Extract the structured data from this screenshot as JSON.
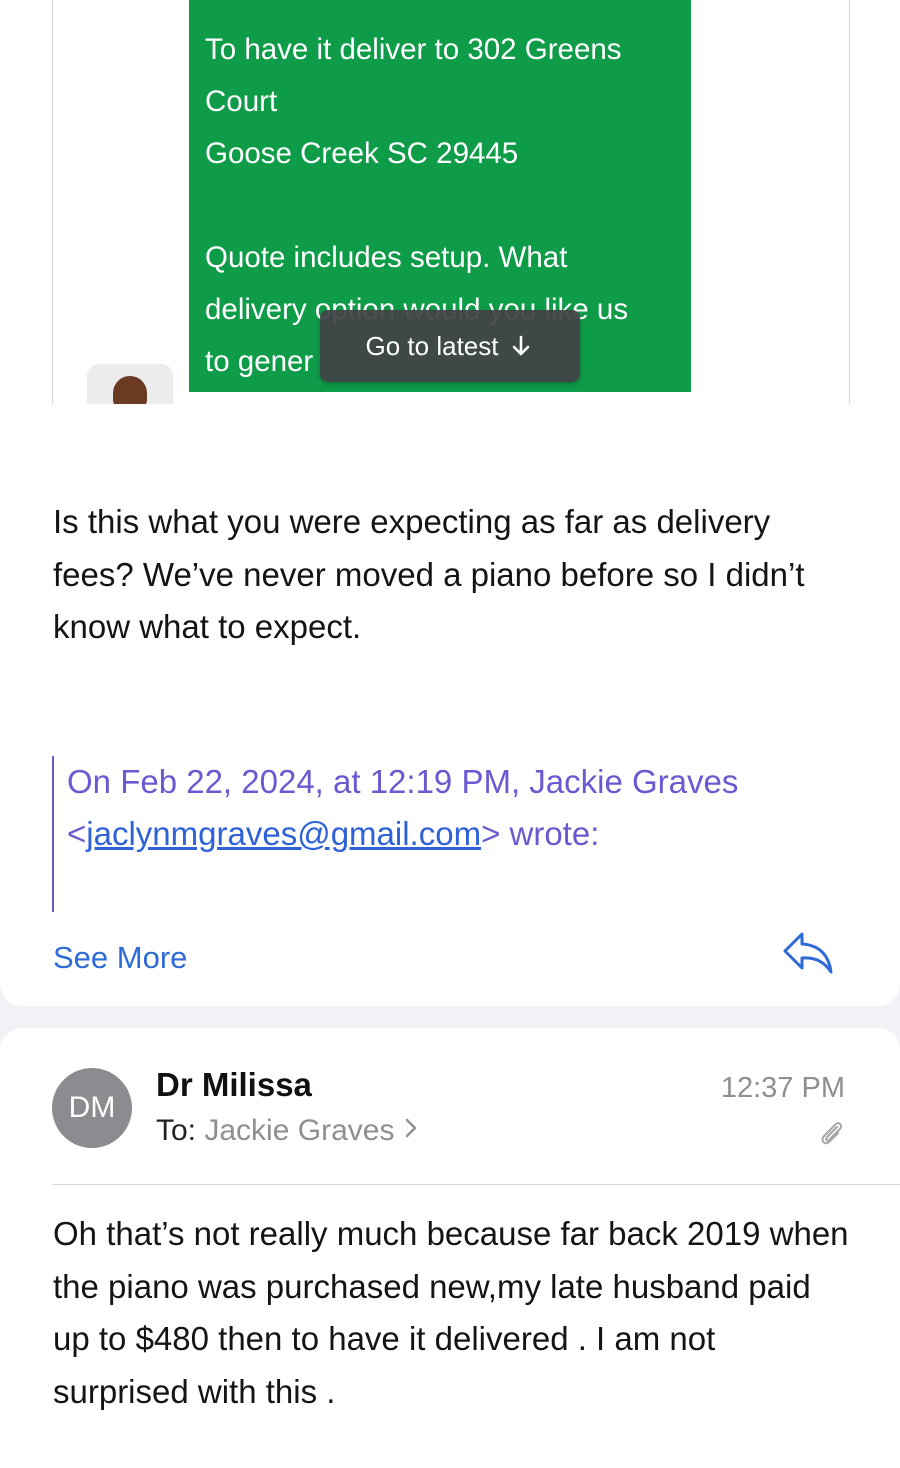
{
  "embedded_message": {
    "lines": [
      "To have it deliver to 302 Greens",
      "Court",
      "Goose Creek SC 29445",
      "",
      "Quote includes setup. What",
      "delivery option would you like us",
      "to gener"
    ],
    "go_to_latest_label": "Go to latest"
  },
  "message1": {
    "body": "Is this what you were expecting as far as delivery fees? We’ve never moved a piano before so I didn’t know what to expect.",
    "quote_prefix": "On Feb 22, 2024, at 12:19 PM, Jackie Graves",
    "quote_email": "jaclynmgraves@gmail.com",
    "quote_suffix": " wrote:",
    "see_more_label": "See More"
  },
  "message2": {
    "avatar_initials": "DM",
    "sender_name": "Dr Milissa",
    "to_label": "To:",
    "recipient": "Jackie Graves",
    "time": "12:37 PM",
    "body": "Oh that’s not really much because far back 2019 when the piano was purchased new,my late husband paid up to $480 then to have it delivered . I am not surprised with this ."
  },
  "colors": {
    "bubble_green": "#0e9c49",
    "link_blue": "#2f6bd6",
    "quote_purple": "#6a5ad2",
    "secondary_gray": "#8e8e93"
  },
  "icons": [
    "arrow-down-icon",
    "reply-icon",
    "chevron-right-icon",
    "paperclip-icon"
  ]
}
